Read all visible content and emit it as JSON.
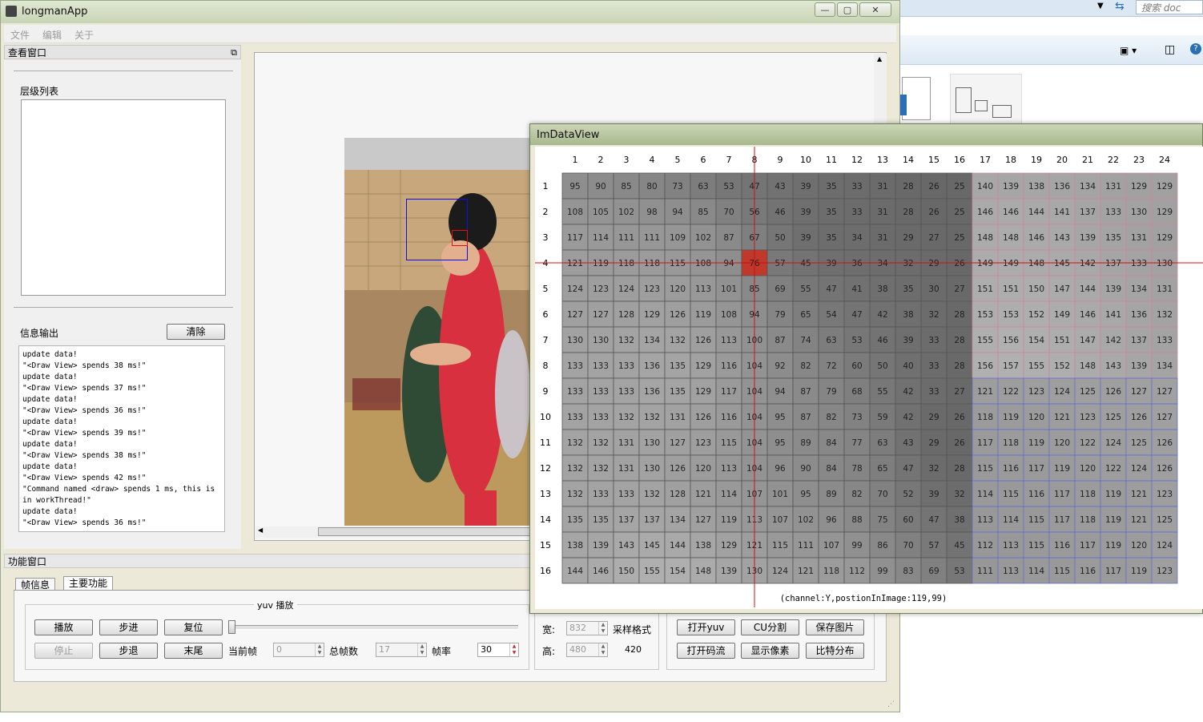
{
  "background_window": {
    "search_placeholder": "搜索 doc"
  },
  "main_window": {
    "title": "longmanApp",
    "menu": [
      "文件",
      "编辑",
      "关于"
    ],
    "view_panel": {
      "title": "查看窗口",
      "layer_list_label": "层级列表",
      "info_label": "信息输出",
      "clear_button": "清除",
      "log_text": "update data!\n\"<Draw View> spends 38 ms!\"\nupdate data!\n\"<Draw View> spends 37 ms!\"\nupdate data!\n\"<Draw View> spends 36 ms!\"\nupdate data!\n\"<Draw View> spends 39 ms!\"\nupdate data!\n\"<Draw View> spends 38 ms!\"\nupdate data!\n\"<Draw View> spends 42 ms!\"\n\"Command named <draw> spends 1 ms, this is in workThread!\"\nupdate data!\n\"<Draw View> spends 36 ms!\""
    },
    "function_panel": {
      "title": "功能窗口",
      "tabs": [
        "帧信息",
        "主要功能"
      ],
      "group_title": "yuv 播放",
      "buttons_row1": [
        "播放",
        "步进",
        "复位"
      ],
      "buttons_row2": [
        "停止",
        "步退",
        "末尾"
      ],
      "current_frame_label": "当前帧",
      "current_frame_value": "0",
      "total_frames_label": "总帧数",
      "total_frames_value": "17",
      "fps_label": "帧率",
      "fps_value": "30",
      "width_label": "宽:",
      "width_value": "832",
      "height_label": "高:",
      "height_value": "480",
      "sampling_label": "采样格式",
      "sampling_value": "420",
      "right_buttons_row1": [
        "打开yuv",
        "CU分割",
        "保存图片"
      ],
      "right_buttons_row2": [
        "打开码流",
        "显示像素",
        "比特分布"
      ]
    }
  },
  "data_view": {
    "title": "ImDataView",
    "status": "(channel:Y,postionInImage:119,99)",
    "columns": [
      1,
      2,
      3,
      4,
      5,
      6,
      7,
      8,
      9,
      10,
      11,
      12,
      13,
      14,
      15,
      16,
      17,
      18,
      19,
      20,
      21,
      22,
      23,
      24
    ],
    "rows": [
      1,
      2,
      3,
      4,
      5,
      6,
      7,
      8,
      9,
      10,
      11,
      12,
      13,
      14,
      15,
      16
    ],
    "selected": {
      "row": 4,
      "col": 8
    },
    "colors": {
      "selected": "#c0392b",
      "crosshair": "#d01010",
      "block_border_a": "#c88a9a",
      "block_border_b": "#6a6ad0"
    },
    "values": [
      [
        95,
        90,
        85,
        80,
        73,
        63,
        53,
        47,
        43,
        39,
        35,
        33,
        31,
        28,
        26,
        25,
        140,
        139,
        138,
        136,
        134,
        131,
        129,
        129
      ],
      [
        108,
        105,
        102,
        98,
        94,
        85,
        70,
        56,
        46,
        39,
        35,
        33,
        31,
        28,
        26,
        25,
        146,
        146,
        144,
        141,
        137,
        133,
        130,
        129
      ],
      [
        117,
        114,
        111,
        111,
        109,
        102,
        87,
        67,
        50,
        39,
        35,
        34,
        31,
        29,
        27,
        25,
        148,
        148,
        146,
        143,
        139,
        135,
        131,
        129
      ],
      [
        121,
        119,
        118,
        118,
        115,
        108,
        94,
        76,
        57,
        45,
        39,
        36,
        34,
        32,
        29,
        26,
        149,
        149,
        148,
        145,
        142,
        137,
        133,
        130
      ],
      [
        124,
        123,
        124,
        123,
        120,
        113,
        101,
        85,
        69,
        55,
        47,
        41,
        38,
        35,
        30,
        27,
        151,
        151,
        150,
        147,
        144,
        139,
        134,
        131
      ],
      [
        127,
        127,
        128,
        129,
        126,
        119,
        108,
        94,
        79,
        65,
        54,
        47,
        42,
        38,
        32,
        28,
        153,
        153,
        152,
        149,
        146,
        141,
        136,
        132
      ],
      [
        130,
        130,
        132,
        134,
        132,
        126,
        113,
        100,
        87,
        74,
        63,
        53,
        46,
        39,
        33,
        28,
        155,
        156,
        154,
        151,
        147,
        142,
        137,
        133
      ],
      [
        133,
        133,
        133,
        136,
        135,
        129,
        116,
        104,
        92,
        82,
        72,
        60,
        50,
        40,
        33,
        28,
        156,
        157,
        155,
        152,
        148,
        143,
        139,
        134
      ],
      [
        133,
        133,
        133,
        136,
        135,
        129,
        117,
        104,
        94,
        87,
        79,
        68,
        55,
        42,
        33,
        27,
        121,
        122,
        123,
        124,
        125,
        126,
        127,
        127
      ],
      [
        133,
        133,
        132,
        132,
        131,
        126,
        116,
        104,
        95,
        87,
        82,
        73,
        59,
        42,
        29,
        26,
        118,
        119,
        120,
        121,
        123,
        125,
        126,
        127
      ],
      [
        132,
        132,
        131,
        130,
        127,
        123,
        115,
        104,
        95,
        89,
        84,
        77,
        63,
        43,
        29,
        26,
        117,
        118,
        119,
        120,
        122,
        124,
        125,
        126
      ],
      [
        132,
        132,
        131,
        130,
        126,
        120,
        113,
        104,
        96,
        90,
        84,
        78,
        65,
        47,
        32,
        28,
        115,
        116,
        117,
        119,
        120,
        122,
        124,
        126
      ],
      [
        132,
        133,
        133,
        132,
        128,
        121,
        114,
        107,
        101,
        95,
        89,
        82,
        70,
        52,
        39,
        32,
        114,
        115,
        116,
        117,
        118,
        119,
        121,
        123
      ],
      [
        135,
        135,
        137,
        137,
        134,
        127,
        119,
        113,
        107,
        102,
        96,
        88,
        75,
        60,
        47,
        38,
        113,
        114,
        115,
        117,
        118,
        119,
        121,
        125
      ],
      [
        138,
        139,
        143,
        145,
        144,
        138,
        129,
        121,
        115,
        111,
        107,
        99,
        86,
        70,
        57,
        45,
        112,
        113,
        115,
        116,
        117,
        119,
        120,
        124
      ],
      [
        144,
        146,
        150,
        155,
        154,
        148,
        139,
        130,
        124,
        121,
        118,
        112,
        99,
        83,
        69,
        53,
        111,
        113,
        114,
        115,
        116,
        117,
        119,
        123
      ]
    ]
  }
}
